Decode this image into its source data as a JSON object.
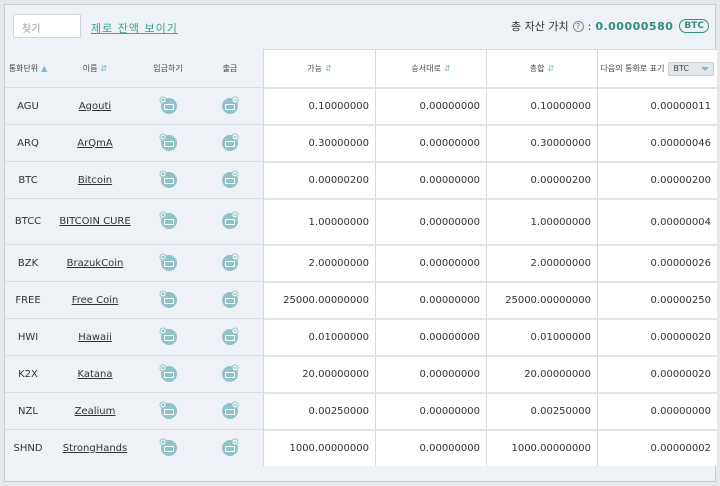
{
  "search": {
    "placeholder": "찾기"
  },
  "zero_balance_link": "제로 잔액 보이기",
  "total": {
    "label": "총 자산 가치",
    "help": "?",
    "sep": ":",
    "value": "0.00000580",
    "unit": "BTC"
  },
  "columns": {
    "currency": "통화단위",
    "name": "이름",
    "deposit": "입금하기",
    "withdraw": "출금",
    "available": "가능",
    "pending": "승서대로",
    "total": "총합",
    "other_currency": "다음의 통화로 표기",
    "other_currency_value": "BTC"
  },
  "rows": [
    {
      "code": "AGU",
      "name": "Agouti",
      "available": "0.10000000",
      "pending": "0.00000000",
      "total": "0.10000000",
      "btc": "0.00000011"
    },
    {
      "code": "ARQ",
      "name": "ArQmA",
      "available": "0.30000000",
      "pending": "0.00000000",
      "total": "0.30000000",
      "btc": "0.00000046"
    },
    {
      "code": "BTC",
      "name": "Bitcoin",
      "available": "0.00000200",
      "pending": "0.00000000",
      "total": "0.00000200",
      "btc": "0.00000200"
    },
    {
      "code": "BTCC",
      "name": "BITCOIN CURE",
      "available": "1.00000000",
      "pending": "0.00000000",
      "total": "1.00000000",
      "btc": "0.00000004"
    },
    {
      "code": "BZK",
      "name": "BrazukCoin",
      "available": "2.00000000",
      "pending": "0.00000000",
      "total": "2.00000000",
      "btc": "0.00000026"
    },
    {
      "code": "FREE",
      "name": "Free Coin",
      "available": "25000.00000000",
      "pending": "0.00000000",
      "total": "25000.00000000",
      "btc": "0.00000250"
    },
    {
      "code": "HWI",
      "name": "Hawaii",
      "available": "0.01000000",
      "pending": "0.00000000",
      "total": "0.01000000",
      "btc": "0.00000020"
    },
    {
      "code": "K2X",
      "name": "Katana",
      "available": "20.00000000",
      "pending": "0.00000000",
      "total": "20.00000000",
      "btc": "0.00000020"
    },
    {
      "code": "NZL",
      "name": "Zealium",
      "available": "0.00250000",
      "pending": "0.00000000",
      "total": "0.00250000",
      "btc": "0.00000000"
    },
    {
      "code": "SHND",
      "name": "StrongHands",
      "available": "1000.00000000",
      "pending": "0.00000000",
      "total": "1000.00000000",
      "btc": "0.00000002"
    }
  ],
  "icons": {
    "deposit": "deposit-icon",
    "withdraw": "withdraw-icon",
    "accent": "#8fc3c9"
  }
}
